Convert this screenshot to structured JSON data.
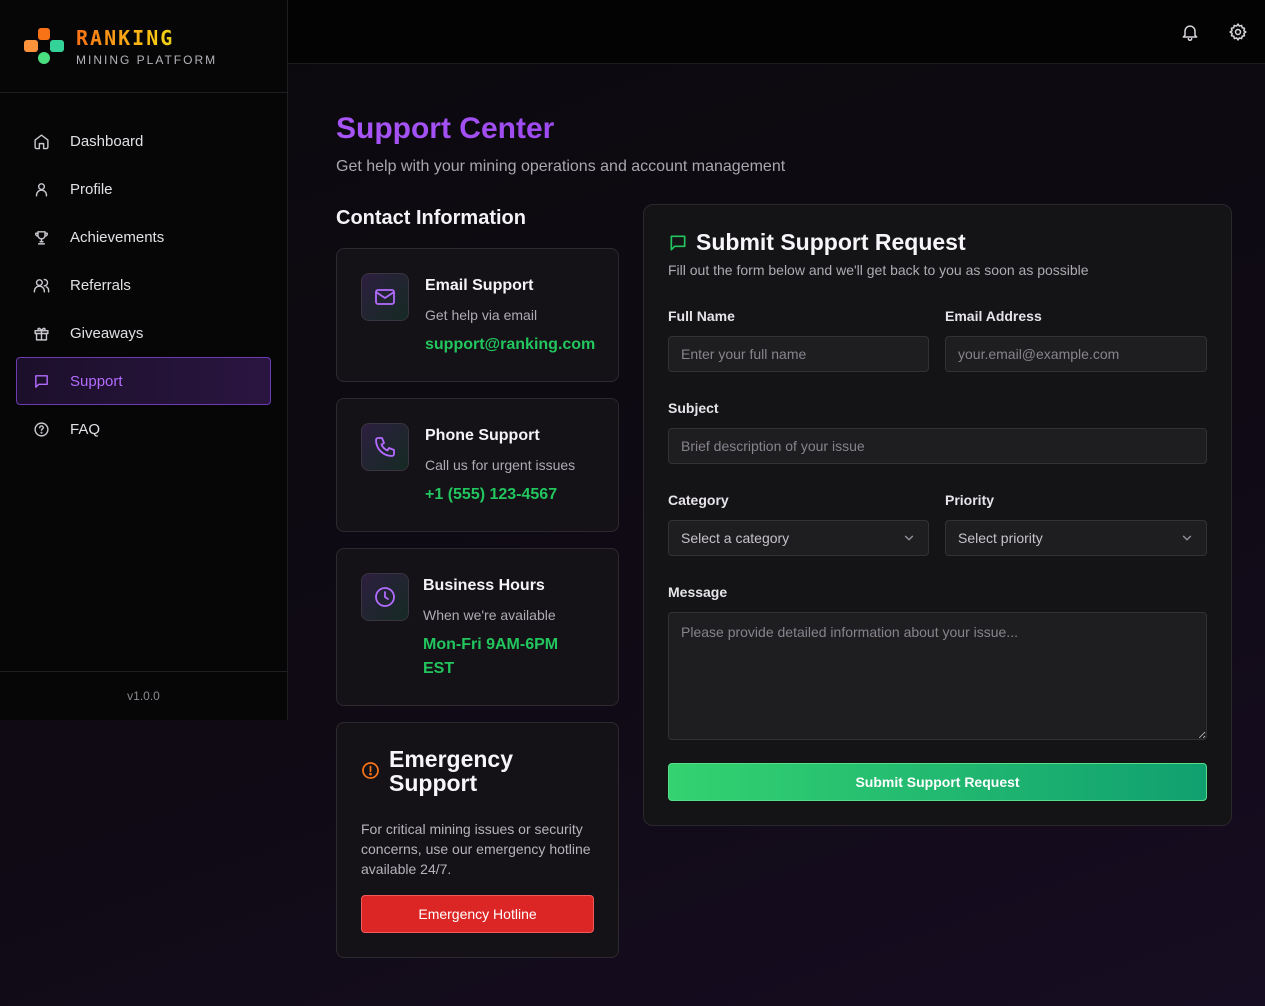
{
  "brand": {
    "name": "RANKING",
    "tagline": "MINING PLATFORM"
  },
  "nav": {
    "items": [
      {
        "label": "Dashboard",
        "icon": "home-icon"
      },
      {
        "label": "Profile",
        "icon": "user-icon"
      },
      {
        "label": "Achievements",
        "icon": "trophy-icon"
      },
      {
        "label": "Referrals",
        "icon": "users-icon"
      },
      {
        "label": "Giveaways",
        "icon": "gift-icon"
      },
      {
        "label": "Support",
        "icon": "message-icon",
        "active": true
      },
      {
        "label": "FAQ",
        "icon": "help-circle-icon"
      }
    ],
    "version": "v1.0.0"
  },
  "topbar": {
    "icons": [
      "bell-icon",
      "gear-icon"
    ]
  },
  "page": {
    "title": "Support Center",
    "subtitle": "Get help with your mining operations and account management"
  },
  "contact": {
    "section_title": "Contact Information",
    "email": {
      "title": "Email Support",
      "desc": "Get help via email",
      "value": "support@ranking.com",
      "icon": "mail-icon"
    },
    "phone": {
      "title": "Phone Support",
      "desc": "Call us for urgent issues",
      "value": "+1 (555) 123-4567",
      "icon": "phone-icon"
    },
    "hours": {
      "title": "Business Hours",
      "desc": "When we're available",
      "value": "Mon-Fri 9AM-6PM EST",
      "icon": "clock-icon"
    }
  },
  "emergency": {
    "title": "Emergency Support",
    "desc": "For critical mining issues or security concerns, use our emergency hotline available 24/7.",
    "button": "Emergency Hotline",
    "icon": "alert-circle-icon"
  },
  "form": {
    "title": "Submit Support Request",
    "subtitle": "Fill out the form below and we'll get back to you as soon as possible",
    "full_name": {
      "label": "Full Name",
      "placeholder": "Enter your full name"
    },
    "email": {
      "label": "Email Address",
      "placeholder": "your.email@example.com"
    },
    "subject": {
      "label": "Subject",
      "placeholder": "Brief description of your issue"
    },
    "category": {
      "label": "Category",
      "value": "Select a category"
    },
    "priority": {
      "label": "Priority",
      "value": "Select priority"
    },
    "message": {
      "label": "Message",
      "placeholder": "Please provide detailed information about your issue..."
    },
    "submit": "Submit Support Request"
  },
  "colors": {
    "accent_purple": "#a855f7",
    "accent_green": "#22c55e",
    "danger": "#dc2626"
  }
}
